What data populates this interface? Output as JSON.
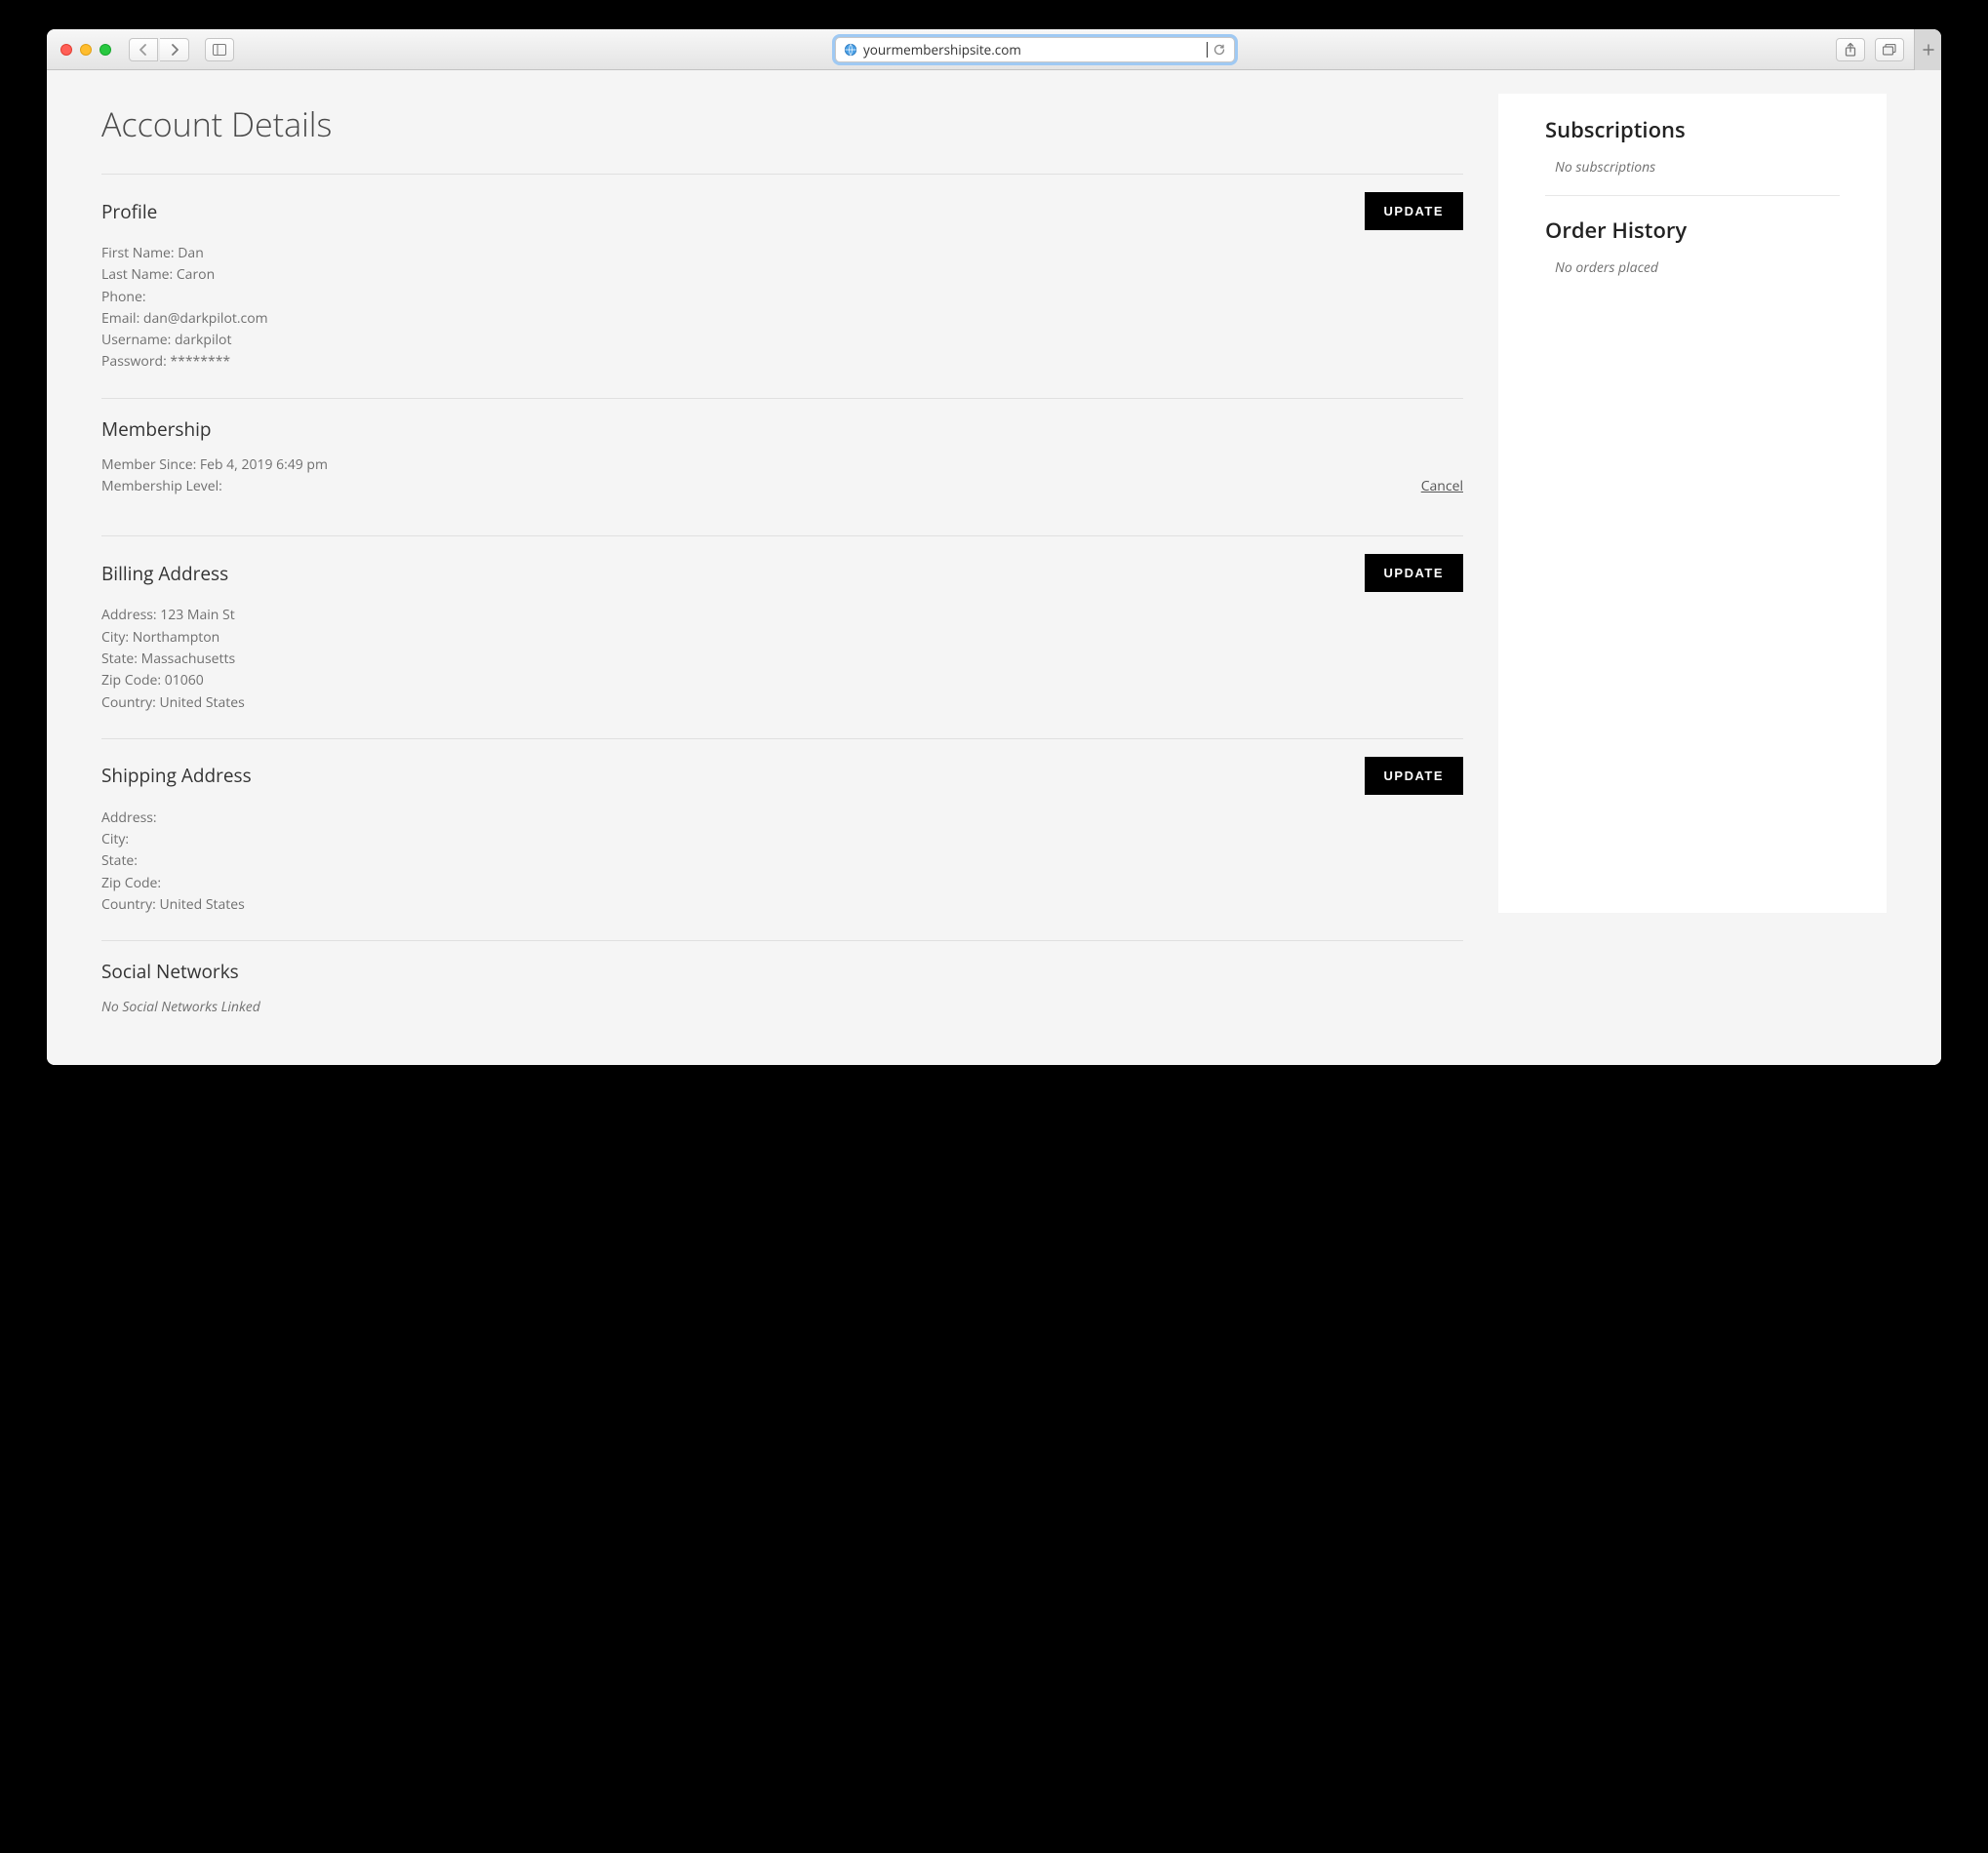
{
  "browser": {
    "url": "yourmembershipsite.com"
  },
  "page_title": "Account Details",
  "profile": {
    "title": "Profile",
    "update_label": "UPDATE",
    "first_name_label": "First Name:",
    "first_name": "Dan",
    "last_name_label": "Last Name:",
    "last_name": "Caron",
    "phone_label": "Phone:",
    "phone": "",
    "email_label": "Email:",
    "email": "dan@darkpilot.com",
    "username_label": "Username:",
    "username": "darkpilot",
    "password_label": "Password:",
    "password": "********"
  },
  "membership": {
    "title": "Membership",
    "since_label": "Member Since:",
    "since": "Feb 4, 2019 6:49 pm",
    "level_label": "Membership Level:",
    "level": "",
    "cancel_label": "Cancel"
  },
  "billing": {
    "title": "Billing Address",
    "update_label": "UPDATE",
    "address_label": "Address:",
    "address": "123 Main St",
    "city_label": "City:",
    "city": "Northampton",
    "state_label": "State:",
    "state": "Massachusetts",
    "zip_label": "Zip Code:",
    "zip": "01060",
    "country_label": "Country:",
    "country": "United States"
  },
  "shipping": {
    "title": "Shipping Address",
    "update_label": "UPDATE",
    "address_label": "Address:",
    "address": "",
    "city_label": "City:",
    "city": "",
    "state_label": "State:",
    "state": "",
    "zip_label": "Zip Code:",
    "zip": "",
    "country_label": "Country:",
    "country": "United States"
  },
  "social": {
    "title": "Social Networks",
    "empty": "No Social Networks Linked"
  },
  "subscriptions": {
    "title": "Subscriptions",
    "empty": "No subscriptions"
  },
  "orders": {
    "title": "Order History",
    "empty": "No orders placed"
  }
}
